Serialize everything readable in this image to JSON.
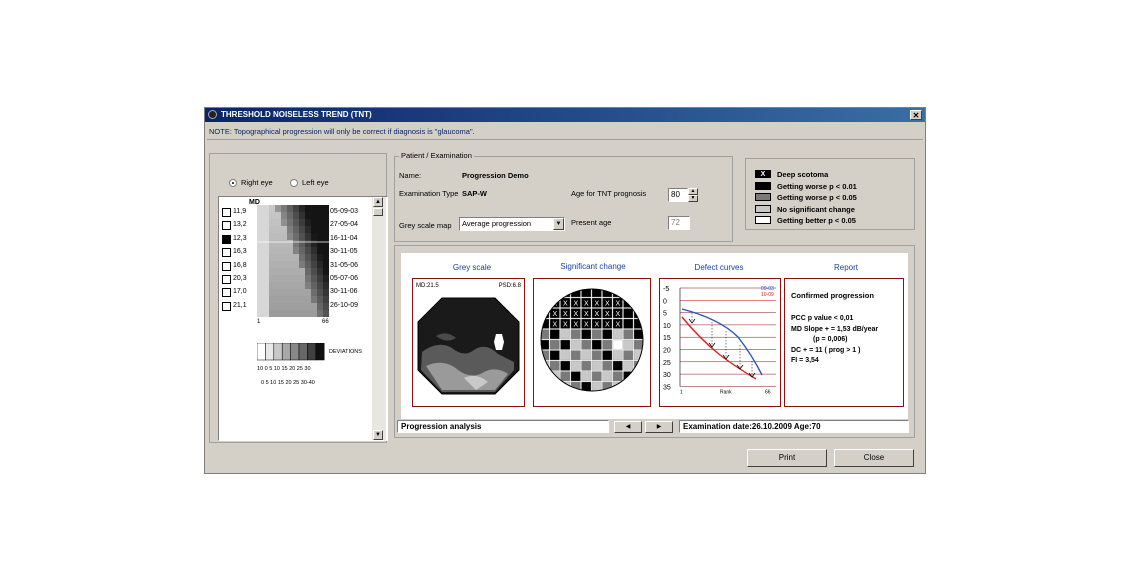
{
  "window": {
    "title": "THRESHOLD NOISELESS TREND (TNT)",
    "close_glyph": "✕",
    "note": "NOTE: Topographical progression will only be correct if diagnosis is \"glaucoma\"."
  },
  "eye_selector": {
    "right_label": "Right eye",
    "left_label": "Left eye",
    "selected": "right"
  },
  "trend_list": {
    "header": "MD",
    "rows": [
      {
        "md": "11,9",
        "date": "05-09-03",
        "selected": false
      },
      {
        "md": "13,2",
        "date": "27-05-04",
        "selected": false
      },
      {
        "md": "12,3",
        "date": "16-11-04",
        "selected": true
      },
      {
        "md": "16,3",
        "date": "30-11-05",
        "selected": false
      },
      {
        "md": "16,8",
        "date": "31-05-06",
        "selected": false
      },
      {
        "md": "20,3",
        "date": "05-07-06",
        "selected": false
      },
      {
        "md": "17,0",
        "date": "30-11-06",
        "selected": false
      },
      {
        "md": "21,1",
        "date": "26-10-09",
        "selected": false
      }
    ],
    "axis_start": "1",
    "axis_end": "66",
    "deviations_label": "DEVIATIONS",
    "scale_row1": "10 0 5 10 15 20 25 30",
    "scale_row2": "0 5 10 15 20 25 30-40"
  },
  "patient": {
    "group_title": "Patient / Examination",
    "name_label": "Name:",
    "name_value": "Progression Demo",
    "exam_type_label": "Examination Type",
    "exam_type_value": "SAP-W",
    "age_prognosis_label": "Age for TNT prognosis",
    "age_prognosis_value": "80",
    "grey_map_label": "Grey scale map",
    "grey_map_value": "Average progression",
    "present_age_label": "Present age",
    "present_age_value": "72"
  },
  "legend": [
    {
      "label": "Deep scotoma",
      "swatch": "#000000",
      "mark": "X"
    },
    {
      "label": "Getting worse p < 0.01",
      "swatch": "#000000",
      "mark": ""
    },
    {
      "label": "Getting worse p < 0.05",
      "swatch": "#7a7a7a",
      "mark": ""
    },
    {
      "label": "No significant change",
      "swatch": "#c8c8c8",
      "mark": ""
    },
    {
      "label": "Getting better p < 0.05",
      "swatch": "#ffffff",
      "mark": ""
    }
  ],
  "sections": {
    "grey_scale": {
      "title": "Grey scale",
      "md": "MD:21.5",
      "psd": "PSD:6.8"
    },
    "significant_change": {
      "title": "Significant change"
    },
    "defect_curves": {
      "title": "Defect curves",
      "legend_blue": "09-03",
      "legend_red": "10-09",
      "y_ticks": [
        "-5",
        "0",
        "5",
        "10",
        "15",
        "20",
        "25",
        "30",
        "35"
      ],
      "x_start": "1",
      "x_mid": "Rank",
      "x_end": "66"
    },
    "report": {
      "title": "Report",
      "heading": "Confirmed progression",
      "lines": [
        "PCC p value < 0,01",
        "MD Slope + = 1,53 dB/year",
        "(p = 0,006)",
        "DC + = 11 ( prog > 1 )",
        "FI = 3,54"
      ]
    }
  },
  "status_bar": {
    "mode": "Progression analysis",
    "prev_glyph": "◀",
    "next_glyph": "▶",
    "exam_info": "Examination date:26.10.2009 Age:70"
  },
  "buttons": {
    "print": "Print",
    "close": "Close"
  },
  "colors": {
    "title_bar": "#0a246a",
    "note_text": "#0a246a",
    "section_title": "#1a3fa0",
    "curve_blue": "#2a4fc8",
    "curve_red": "#e02020"
  }
}
